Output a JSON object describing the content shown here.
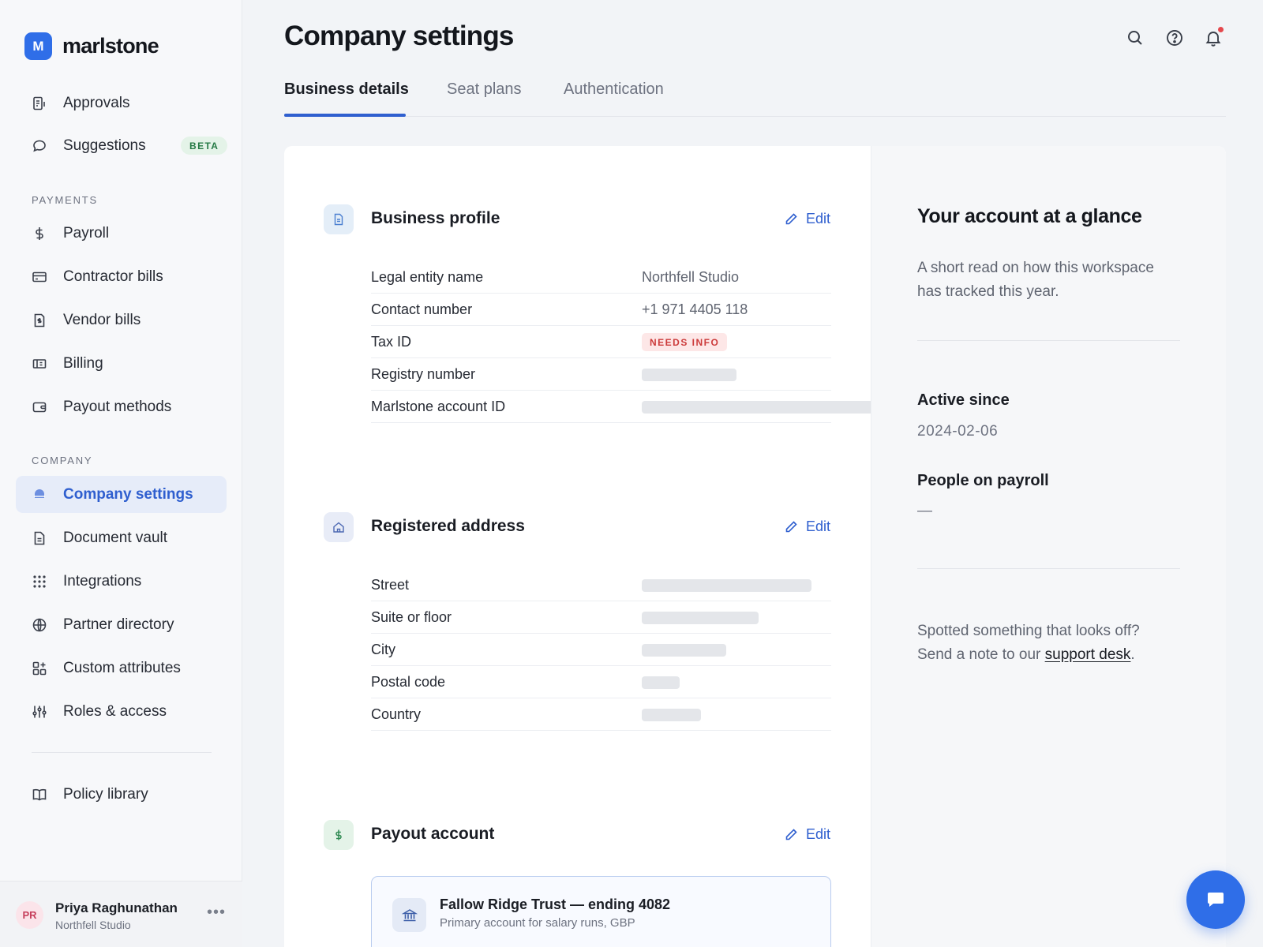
{
  "brand": {
    "logo_letter": "M",
    "name": "marlstone"
  },
  "sidebar": {
    "top_items": [
      {
        "label": "Approvals",
        "icon": "approvals-icon"
      },
      {
        "label": "Suggestions",
        "icon": "chat-bubble-icon",
        "badge": "BETA"
      }
    ],
    "payments_label": "PAYMENTS",
    "payments_items": [
      {
        "label": "Payroll",
        "icon": "dollar-icon"
      },
      {
        "label": "Contractor bills",
        "icon": "credit-card-icon"
      },
      {
        "label": "Vendor bills",
        "icon": "invoice-icon"
      },
      {
        "label": "Billing",
        "icon": "billing-icon"
      },
      {
        "label": "Payout methods",
        "icon": "wallet-icon"
      }
    ],
    "company_label": "COMPANY",
    "company_items": [
      {
        "label": "Company settings",
        "icon": "company-icon",
        "active": true
      },
      {
        "label": "Document vault",
        "icon": "document-icon"
      },
      {
        "label": "Integrations",
        "icon": "grid-dots-icon"
      },
      {
        "label": "Partner directory",
        "icon": "globe-icon"
      },
      {
        "label": "Custom attributes",
        "icon": "attributes-icon"
      },
      {
        "label": "Roles & access",
        "icon": "sliders-icon"
      }
    ],
    "bottom_items": [
      {
        "label": "Policy library",
        "icon": "book-icon"
      }
    ]
  },
  "user": {
    "initials": "PR",
    "name": "Priya Raghunathan",
    "org": "Northfell Studio",
    "more": "•••"
  },
  "header": {
    "title": "Company settings",
    "icons": [
      "search-icon",
      "help-icon",
      "bell-icon"
    ]
  },
  "tabs": [
    {
      "label": "Business details",
      "active": true
    },
    {
      "label": "Seat plans"
    },
    {
      "label": "Authentication"
    }
  ],
  "business_profile": {
    "title": "Business profile",
    "edit": "Edit",
    "rows": [
      {
        "label": "Legal entity name",
        "value": "Northfell Studio"
      },
      {
        "label": "Contact number",
        "value": "+1 971 4405 118"
      },
      {
        "label": "Tax ID",
        "badge": "NEEDS INFO"
      },
      {
        "label": "Registry number",
        "value": null
      },
      {
        "label": "Marlstone account ID",
        "value": null
      }
    ]
  },
  "registered_address": {
    "title": "Registered address",
    "edit": "Edit",
    "rows": [
      {
        "label": "Street",
        "value": null
      },
      {
        "label": "Suite or floor",
        "value": null
      },
      {
        "label": "City",
        "value": null
      },
      {
        "label": "Postal code",
        "value": null
      },
      {
        "label": "Country",
        "value": null
      }
    ]
  },
  "payout_account": {
    "title": "Payout account",
    "edit": "Edit",
    "bank_name": "Fallow Ridge Trust — ending 4082",
    "bank_sub": "Primary account for salary runs, GBP"
  },
  "glance": {
    "title": "Your account at a glance",
    "desc": "A short read on how this workspace has tracked this year.",
    "active_since_label": "Active since",
    "active_since_value": "2024-02-06",
    "payroll_label": "People on payroll",
    "payroll_value": "—",
    "support_prefix": "Spotted something that looks off? Send a note to our ",
    "support_link": "support desk",
    "support_suffix": "."
  },
  "colors": {
    "accent": "#2f5fcf",
    "brand": "#2f6ee8",
    "warning": "#cc3b3b",
    "beta": "#257a45"
  }
}
